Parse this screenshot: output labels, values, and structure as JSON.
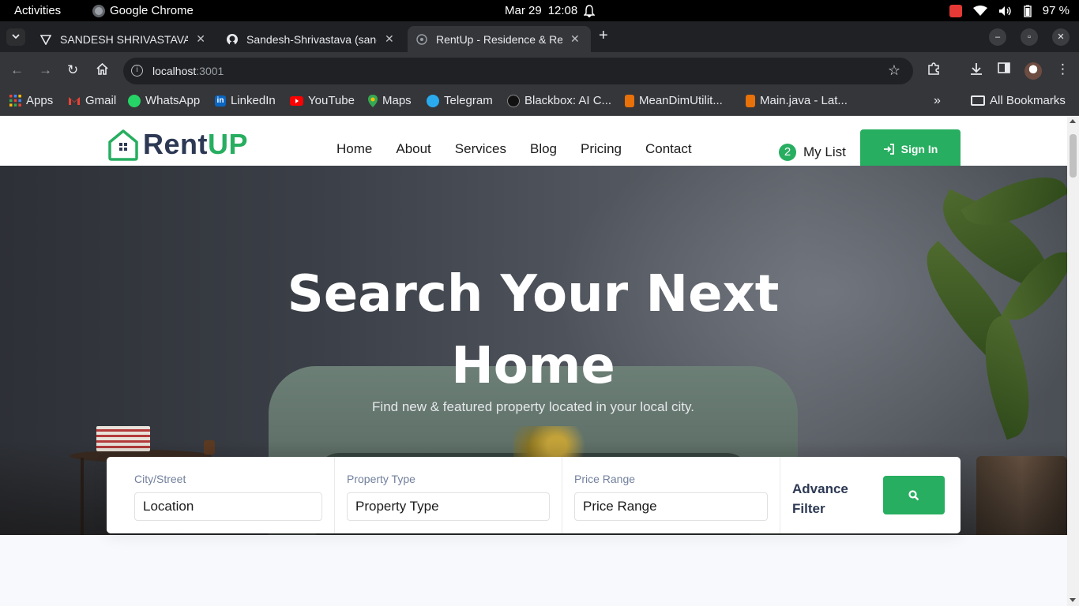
{
  "system": {
    "activities": "Activities",
    "app_name": "Google Chrome",
    "date": "Mar 29",
    "time": "12:08",
    "battery": "97 %"
  },
  "browser": {
    "tabs": [
      {
        "title": "SANDESH SHRIVASTAVA"
      },
      {
        "title": "Sandesh-Shrivastava (sandesh"
      },
      {
        "title": "RentUp - Residence & Real Estate"
      }
    ],
    "url_host": "localhost",
    "url_port": ":3001",
    "bookmarks": [
      {
        "label": "Apps"
      },
      {
        "label": "Gmail"
      },
      {
        "label": "WhatsApp"
      },
      {
        "label": "LinkedIn"
      },
      {
        "label": "YouTube"
      },
      {
        "label": "Maps"
      },
      {
        "label": "Telegram"
      },
      {
        "label": "Blackbox: AI C..."
      },
      {
        "label": "MeanDimUtilit..."
      },
      {
        "label": "Main.java - Lat..."
      }
    ],
    "all_bookmarks": "All Bookmarks"
  },
  "site": {
    "logo_rent": "Rent",
    "logo_up": "UP",
    "nav": [
      "Home",
      "About",
      "Services",
      "Blog",
      "Pricing",
      "Contact"
    ],
    "mylist_count": "2",
    "mylist_label": "My List",
    "signin_label": "Sign In",
    "colors": {
      "accent": "#27ae60",
      "dark": "#2d3954"
    }
  },
  "hero": {
    "title_line1": "Search Your Next",
    "title_line2": "Home",
    "subtitle": "Find new & featured property located in your local city."
  },
  "search": {
    "city_label": "City/Street",
    "city_value": "Location",
    "type_label": "Property Type",
    "type_value": "Property Type",
    "price_label": "Price Range",
    "price_value": "Price Range",
    "advance_line1": "Advance",
    "advance_line2": "Filter"
  }
}
